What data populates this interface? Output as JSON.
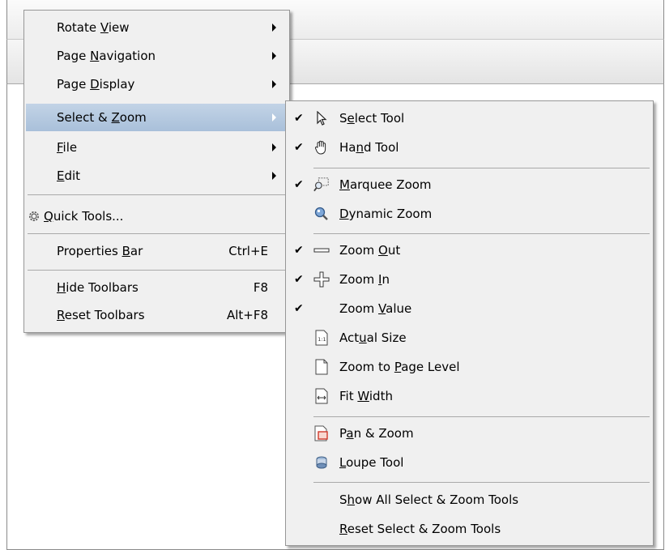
{
  "context_menu": {
    "items": [
      {
        "pre": "Rotate ",
        "u": "V",
        "post": "iew",
        "submenu": true
      },
      {
        "pre": "Page ",
        "u": "N",
        "post": "avigation",
        "submenu": true
      },
      {
        "pre": "Page ",
        "u": "D",
        "post": "isplay",
        "submenu": true
      },
      {
        "pre": "Select & ",
        "u": "Z",
        "post": "oom",
        "submenu": true,
        "highlighted": true
      },
      {
        "pre": "",
        "u": "F",
        "post": "ile",
        "submenu": true
      },
      {
        "pre": "",
        "u": "E",
        "post": "dit",
        "submenu": true
      },
      {
        "pre": "",
        "u": "Q",
        "post": "uick Tools...",
        "icon": "gear-icon"
      },
      {
        "pre": "Properties ",
        "u": "B",
        "post": "ar",
        "shortcut": "Ctrl+E"
      },
      {
        "pre": "",
        "u": "H",
        "post": "ide Toolbars",
        "shortcut": "F8"
      },
      {
        "pre": "",
        "u": "R",
        "post": "eset Toolbars",
        "shortcut": "Alt+F8"
      }
    ]
  },
  "submenu": {
    "items": [
      {
        "pre": "S",
        "u": "e",
        "post": "lect Tool",
        "checked": true,
        "icon": "arrow-pointer-icon"
      },
      {
        "pre": "Ha",
        "u": "n",
        "post": "d Tool",
        "checked": true,
        "icon": "hand-icon"
      },
      {
        "pre": "",
        "u": "M",
        "post": "arquee Zoom",
        "checked": true,
        "icon": "marquee-zoom-icon"
      },
      {
        "pre": "",
        "u": "D",
        "post": "ynamic Zoom",
        "checked": false,
        "icon": "dynamic-zoom-icon"
      },
      {
        "pre": "Zoom ",
        "u": "O",
        "post": "ut",
        "checked": true,
        "icon": "minus-icon"
      },
      {
        "pre": "Zoom ",
        "u": "I",
        "post": "n",
        "checked": true,
        "icon": "plus-icon"
      },
      {
        "pre": "Zoom ",
        "u": "V",
        "post": "alue",
        "checked": true,
        "icon": ""
      },
      {
        "pre": "Act",
        "u": "u",
        "post": "al Size",
        "checked": false,
        "icon": "actual-size-icon"
      },
      {
        "pre": "Zoom to ",
        "u": "P",
        "post": "age Level",
        "checked": false,
        "icon": "page-icon"
      },
      {
        "pre": "Fit ",
        "u": "W",
        "post": "idth",
        "checked": false,
        "icon": "fit-width-icon"
      },
      {
        "pre": "P",
        "u": "a",
        "post": "n & Zoom",
        "checked": false,
        "icon": "pan-zoom-icon"
      },
      {
        "pre": "",
        "u": "L",
        "post": "oupe Tool",
        "checked": false,
        "icon": "loupe-icon"
      },
      {
        "pre": "S",
        "u": "h",
        "post": "ow All Select & Zoom Tools",
        "checked": false,
        "icon": ""
      },
      {
        "pre": "",
        "u": "R",
        "post": "eset Select & Zoom Tools",
        "checked": false,
        "icon": ""
      }
    ],
    "check_mark": "✔"
  }
}
